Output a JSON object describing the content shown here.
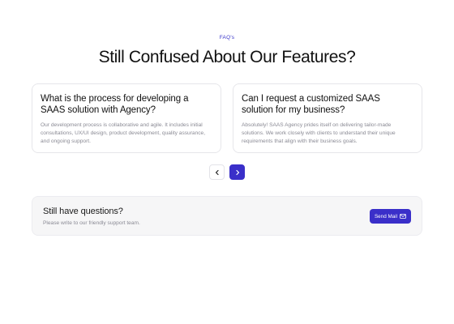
{
  "section": {
    "eyebrow": "FAQ's",
    "title": "Still Confused About Our Features?"
  },
  "faqs": [
    {
      "question": "What is the process for developing a SAAS solution with Agency?",
      "answer": "Our development process is collaborative and agile. It includes initial consultations, UX/UI design, product development, quality assurance, and ongoing support."
    },
    {
      "question": "Can I request a customized SAAS solution for my business?",
      "answer": "Absolutely! SAAS Agency prides itself on delivering tailor-made solutions. We work closely with clients to understand their unique requirements that align with their business goals."
    }
  ],
  "carousel": {
    "prev_icon": "chevron-left-icon",
    "next_icon": "chevron-right-icon"
  },
  "cta": {
    "title": "Still have questions?",
    "subtitle": "Please write to our friendly support team.",
    "button_label": "Send Mail",
    "button_icon": "mail-icon"
  },
  "colors": {
    "accent": "#3a2fc9",
    "muted_text": "#8a8a94",
    "border": "#e6e6ea"
  }
}
